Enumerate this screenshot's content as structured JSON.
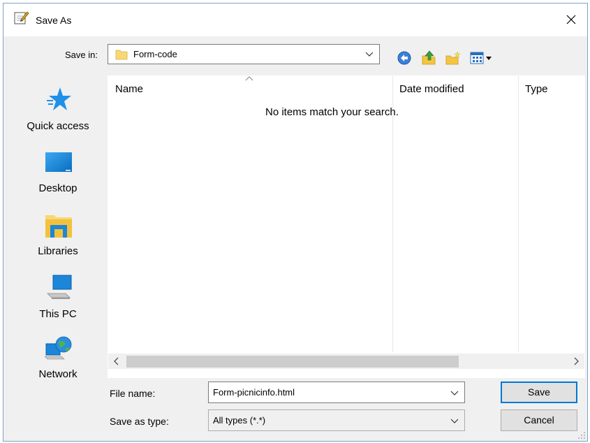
{
  "window": {
    "title": "Save As"
  },
  "toolbar": {
    "save_in_label": "Save in:",
    "save_in_value": "Form-code",
    "icons": [
      "back-icon",
      "up-folder-icon",
      "new-folder-icon",
      "view-menu-icon"
    ]
  },
  "places": [
    {
      "label": "Quick access",
      "icon": "quick-access-star-icon"
    },
    {
      "label": "Desktop",
      "icon": "desktop-icon"
    },
    {
      "label": "Libraries",
      "icon": "libraries-icon"
    },
    {
      "label": "This PC",
      "icon": "this-pc-icon"
    },
    {
      "label": "Network",
      "icon": "network-icon"
    }
  ],
  "file_list": {
    "columns": [
      "Name",
      "Date modified",
      "Type"
    ],
    "empty_message": "No items match your search."
  },
  "footer": {
    "file_name_label": "File name:",
    "file_name_value": "Form-picnicinfo.html",
    "save_type_label": "Save as type:",
    "save_type_value": "All types (*.*)",
    "save_button": "Save",
    "cancel_button": "Cancel"
  },
  "colors": {
    "accent": "#0078d7",
    "folder": "#f8d775",
    "window_bg": "#f0f0f0"
  }
}
